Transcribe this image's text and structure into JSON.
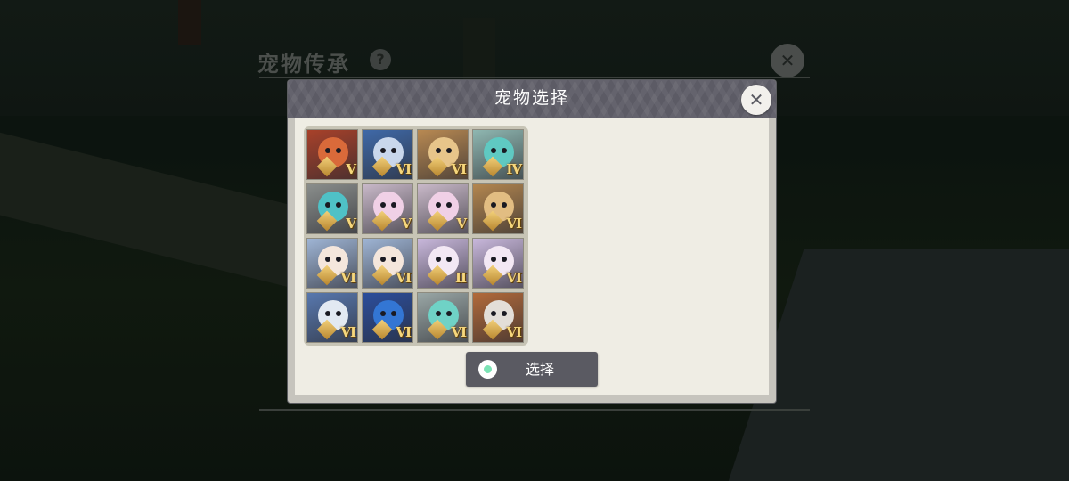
{
  "background_panel": {
    "title": "宠物传承",
    "help_icon": "?",
    "close_icon": "✕"
  },
  "dialog": {
    "title": "宠物选择",
    "close_icon": "✕",
    "select_button_label": "选择"
  },
  "pets": [
    {
      "name": "red-dragon-icon",
      "tier": "V",
      "bg": "#a8412a",
      "face": "#d96a3a"
    },
    {
      "name": "ice-beast-icon",
      "tier": "VI",
      "bg": "#3f69a8",
      "face": "#c9d7ec"
    },
    {
      "name": "squirrel-icon",
      "tier": "VI",
      "bg": "#b88952",
      "face": "#e7c58a"
    },
    {
      "name": "sea-dragon-icon",
      "tier": "IV",
      "bg": "#8fb7b1",
      "face": "#5fc9c2"
    },
    {
      "name": "blue-blob-icon",
      "tier": "V",
      "bg": "#8a8e8c",
      "face": "#4fc1c6"
    },
    {
      "name": "pink-fox-girl-icon",
      "tier": "V",
      "bg": "#c9b9c9",
      "face": "#f0d0e6"
    },
    {
      "name": "pink-fox-girl-icon",
      "tier": "V",
      "bg": "#c9b9c9",
      "face": "#f0d0e6"
    },
    {
      "name": "squirrel-icon",
      "tier": "VI",
      "bg": "#b3864f",
      "face": "#e2bd82"
    },
    {
      "name": "white-gold-maiden-icon",
      "tier": "VI",
      "bg": "#9fb5d5",
      "face": "#f4e6dc"
    },
    {
      "name": "white-gold-maiden-icon",
      "tier": "VI",
      "bg": "#9fb5d5",
      "face": "#f4e6dc"
    },
    {
      "name": "silver-hair-girl-icon",
      "tier": "II",
      "bg": "#c9b8dc",
      "face": "#f3e8f4"
    },
    {
      "name": "silver-hair-girl-icon",
      "tier": "VI",
      "bg": "#c9b8dc",
      "face": "#f3e8f4"
    },
    {
      "name": "white-tiger-icon",
      "tier": "VI",
      "bg": "#5878ae",
      "face": "#e2e9f2"
    },
    {
      "name": "blue-bird-icon",
      "tier": "VI",
      "bg": "#2b4e9c",
      "face": "#3376d4"
    },
    {
      "name": "teal-dragon-icon",
      "tier": "VI",
      "bg": "#9aa7a6",
      "face": "#6fd2c6"
    },
    {
      "name": "griffin-icon",
      "tier": "VI",
      "bg": "#b26a3a",
      "face": "#e3ded8"
    }
  ]
}
